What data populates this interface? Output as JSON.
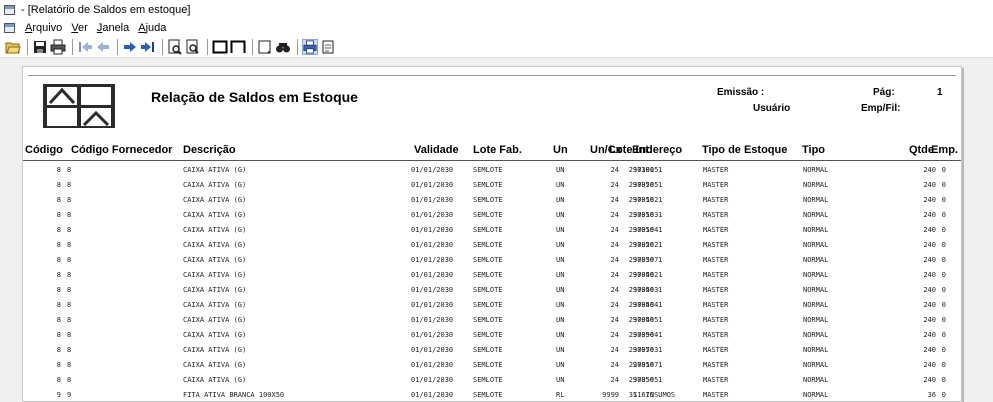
{
  "window": {
    "title": "- [Relatório de Saldos em estoque]"
  },
  "menu": [
    {
      "label": "Arquivo",
      "key": "A",
      "rest": "rquivo"
    },
    {
      "label": "Ver",
      "key": "V",
      "rest": "er"
    },
    {
      "label": "Janela",
      "key": "J",
      "rest": "anela"
    },
    {
      "label": "Ajuda",
      "key": "A",
      "rest": "juda"
    }
  ],
  "toolbar": [
    "open-icon",
    "save-icon",
    "print-icon",
    "first-page-icon",
    "previous-page-icon",
    "next-page-icon",
    "last-page-icon",
    "zoom-in-icon",
    "zoom-out-icon",
    "single-page-icon",
    "two-pages-icon",
    "page-setup-icon",
    "find-icon",
    "print-preview-icon",
    "export-icon"
  ],
  "report": {
    "title": "Relação de Saldos em Estoque",
    "emissao_label": "Emissão :",
    "usuario_label": "Usuário",
    "pag_label": "Pág:",
    "pag_value": "1",
    "empfil_label": "Emp/Fil:",
    "columns": [
      "Código",
      "Código Fornecedor",
      "Descrição",
      "Lote Int.",
      "Validade",
      "Lote Fab.",
      "Un",
      "Un/Cx",
      "Endereço",
      "Tipo de Estoque",
      "Tipo",
      "Qtde",
      "Emp."
    ],
    "rows": [
      [
        "8",
        "8",
        "CAIXA ATIVA (G)",
        "297381",
        "01/01/2030",
        "SEMLOTE",
        "UN",
        "24",
        "3010051",
        "MASTER",
        "NORMAL",
        "240",
        "0"
      ],
      [
        "8",
        "8",
        "CAIXA ATIVA (G)",
        "297956",
        "01/01/2030",
        "SEMLOTE",
        "UN",
        "24",
        "3007051",
        "MASTER",
        "NORMAL",
        "240",
        "0"
      ],
      [
        "8",
        "8",
        "CAIXA ATIVA (G)",
        "297956",
        "01/01/2030",
        "SEMLOTE",
        "UN",
        "24",
        "3001021",
        "MASTER",
        "NORMAL",
        "240",
        "0"
      ],
      [
        "8",
        "8",
        "CAIXA ATIVA (G)",
        "297956",
        "01/01/2030",
        "SEMLOTE",
        "UN",
        "24",
        "3001031",
        "MASTER",
        "NORMAL",
        "240",
        "0"
      ],
      [
        "8",
        "8",
        "CAIXA ATIVA (G)",
        "297956",
        "01/01/2030",
        "SEMLOTE",
        "UN",
        "24",
        "3001041",
        "MASTER",
        "NORMAL",
        "240",
        "0"
      ],
      [
        "8",
        "8",
        "CAIXA ATIVA (G)",
        "297956",
        "01/01/2030",
        "SEMLOTE",
        "UN",
        "24",
        "3002021",
        "MASTER",
        "NORMAL",
        "240",
        "0"
      ],
      [
        "8",
        "8",
        "CAIXA ATIVA (G)",
        "297956",
        "01/01/2030",
        "SEMLOTE",
        "UN",
        "24",
        "3003071",
        "MASTER",
        "NORMAL",
        "240",
        "0"
      ],
      [
        "8",
        "8",
        "CAIXA ATIVA (G)",
        "297956",
        "01/01/2030",
        "SEMLOTE",
        "UN",
        "24",
        "3004021",
        "MASTER",
        "NORMAL",
        "240",
        "0"
      ],
      [
        "8",
        "8",
        "CAIXA ATIVA (G)",
        "297956",
        "01/01/2030",
        "SEMLOTE",
        "UN",
        "24",
        "3004031",
        "MASTER",
        "NORMAL",
        "240",
        "0"
      ],
      [
        "8",
        "8",
        "CAIXA ATIVA (G)",
        "297956",
        "01/01/2030",
        "SEMLOTE",
        "UN",
        "24",
        "3004041",
        "MASTER",
        "NORMAL",
        "240",
        "0"
      ],
      [
        "8",
        "8",
        "CAIXA ATIVA (G)",
        "297956",
        "01/01/2030",
        "SEMLOTE",
        "UN",
        "24",
        "3004051",
        "MASTER",
        "NORMAL",
        "240",
        "0"
      ],
      [
        "8",
        "8",
        "CAIXA ATIVA (G)",
        "297956",
        "01/01/2030",
        "SEMLOTE",
        "UN",
        "24",
        "3009041",
        "MASTER",
        "NORMAL",
        "240",
        "0"
      ],
      [
        "8",
        "8",
        "CAIXA ATIVA (G)",
        "297956",
        "01/01/2030",
        "SEMLOTE",
        "UN",
        "24",
        "3007031",
        "MASTER",
        "NORMAL",
        "240",
        "0"
      ],
      [
        "8",
        "8",
        "CAIXA ATIVA (G)",
        "297956",
        "01/01/2030",
        "SEMLOTE",
        "UN",
        "24",
        "2001071",
        "MASTER",
        "NORMAL",
        "240",
        "0"
      ],
      [
        "8",
        "8",
        "CAIXA ATIVA (G)",
        "297956",
        "01/01/2030",
        "SEMLOTE",
        "UN",
        "24",
        "3005051",
        "MASTER",
        "NORMAL",
        "240",
        "0"
      ],
      [
        "9",
        "9",
        "FITA ATIVA BRANCA 100X50",
        "311670",
        "01/01/2030",
        "SEMLOTE",
        "RL",
        "9999",
        "S. INSUMOS",
        "MASTER",
        "NORMAL",
        "36",
        "0"
      ]
    ]
  }
}
